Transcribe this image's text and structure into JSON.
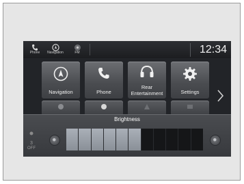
{
  "topbar": {
    "shortcuts": [
      {
        "label": "Phone",
        "icon": "phone-icon"
      },
      {
        "label": "Navigation",
        "icon": "navigation-icon"
      },
      {
        "label": "FM",
        "icon": "radio-icon"
      }
    ],
    "clock": "12:34"
  },
  "home": {
    "tiles": [
      {
        "label": "Navigation",
        "icon": "compass-icon"
      },
      {
        "label": "Phone",
        "icon": "phone-icon"
      },
      {
        "label": "Rear\nEntertainment",
        "icon": "headphones-icon"
      },
      {
        "label": "Settings",
        "icon": "gear-icon"
      }
    ],
    "next_icon": "chevron-right-icon"
  },
  "brightness": {
    "title": "Brightness",
    "side_value": "3",
    "side_off": "OFF",
    "level": 6,
    "max": 11,
    "colors": {
      "filled": "#aab0b8",
      "empty": "#151618"
    }
  }
}
